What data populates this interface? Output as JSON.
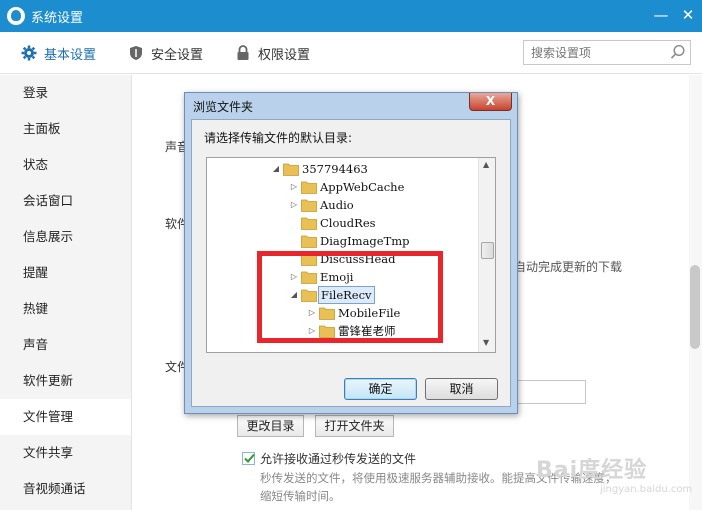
{
  "window": {
    "title": "系统设置",
    "minimize": "—",
    "close": "✕"
  },
  "tabs": [
    {
      "label": "基本设置",
      "icon": "gear-icon",
      "active": true
    },
    {
      "label": "安全设置",
      "icon": "shield-icon",
      "active": false
    },
    {
      "label": "权限设置",
      "icon": "lock-icon",
      "active": false
    }
  ],
  "search": {
    "placeholder": "搜索设置项"
  },
  "sidebar": {
    "items": [
      {
        "label": "登录"
      },
      {
        "label": "主面板"
      },
      {
        "label": "状态"
      },
      {
        "label": "会话窗口"
      },
      {
        "label": "信息展示"
      },
      {
        "label": "提醒"
      },
      {
        "label": "热键"
      },
      {
        "label": "声音"
      },
      {
        "label": "软件更新"
      },
      {
        "label": "文件管理"
      },
      {
        "label": "文件共享"
      },
      {
        "label": "音视频通话"
      }
    ],
    "active_index": 9
  },
  "content": {
    "partial_label_1": "声音",
    "partial_label_2": "软件",
    "partial_label_3": "文件",
    "partial_text_update": "自动完成更新的下载",
    "change_dir_button": "更改目录",
    "open_folder_button": "打开文件夹",
    "checkbox_label": "允许接收通过秒传发送的文件",
    "checkbox_checked": true,
    "note": "秒传发送的文件，将使用极速服务器辅助接收。能提高文件传输速度，缩短传输时间。"
  },
  "dialog": {
    "title": "浏览文件夹",
    "close": "X",
    "prompt": "请选择传输文件的默认目录:",
    "tree": [
      {
        "label": "357794463",
        "expander": "expanded",
        "depth": 0
      },
      {
        "label": "AppWebCache",
        "expander": "collapsed",
        "depth": 1
      },
      {
        "label": "Audio",
        "expander": "collapsed",
        "depth": 1
      },
      {
        "label": "CloudRes",
        "expander": "none",
        "depth": 1
      },
      {
        "label": "DiagImageTmp",
        "expander": "none",
        "depth": 1
      },
      {
        "label": "DiscussHead",
        "expander": "none",
        "depth": 1
      },
      {
        "label": "Emoji",
        "expander": "collapsed",
        "depth": 1
      },
      {
        "label": "FileRecv",
        "expander": "expanded",
        "depth": 1,
        "selected": true
      },
      {
        "label": "MobileFile",
        "expander": "collapsed",
        "depth": 2
      },
      {
        "label": "雷锋崔老师",
        "expander": "collapsed",
        "depth": 2
      }
    ],
    "ok_button": "确定",
    "cancel_button": "取消"
  },
  "watermark": {
    "text": "Bai度经验",
    "sub": "jingyan.baidu.com"
  },
  "colors": {
    "titlebar": "#1c8dcf",
    "highlight_box": "#e8262c",
    "folder": "#e8c056"
  }
}
